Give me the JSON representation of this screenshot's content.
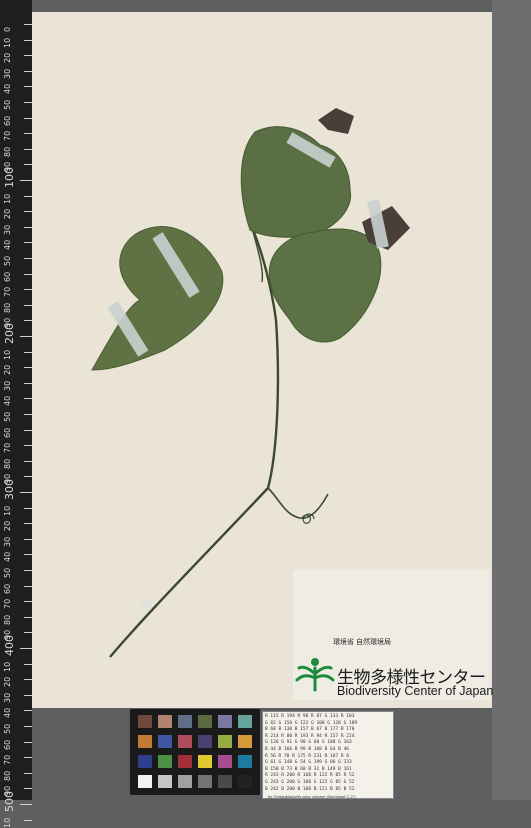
{
  "ruler": {
    "labels": [
      "0",
      "10",
      "20",
      "30",
      "40",
      "50",
      "60",
      "70",
      "80",
      "90",
      "100",
      "10",
      "20",
      "30",
      "40",
      "50",
      "60",
      "70",
      "80",
      "90",
      "200",
      "10",
      "20",
      "30",
      "40",
      "50",
      "60",
      "70",
      "80",
      "90",
      "300",
      "10",
      "20",
      "30",
      "40",
      "50",
      "60",
      "70",
      "80",
      "90",
      "400",
      "10",
      "20",
      "30",
      "40",
      "50",
      "60",
      "70",
      "80",
      "90",
      "500",
      "10"
    ],
    "colors": {
      "bg": "#1f1f20",
      "ink": "#d8d8d8"
    }
  },
  "institution": {
    "small_text": "環境省 自然環境局",
    "name_jp": "生物多様性センター",
    "name_en": "Biodiversity Center of Japan",
    "logo_color": "#1c8b3a"
  },
  "checker": {
    "swatches": [
      "#6d4a3c",
      "#b08372",
      "#5e6f87",
      "#5a6b44",
      "#7a78a0",
      "#66a39a",
      "#c27a35",
      "#3f56a0",
      "#b04b5b",
      "#4c3f71",
      "#95ad3f",
      "#d59a3a",
      "#2d3e8f",
      "#4d8f45",
      "#a03035",
      "#e3c72e",
      "#a64d92",
      "#1f7aa1",
      "#f1f1f1",
      "#c7c7c7",
      "#a0a0a0",
      "#747474",
      "#4a4a4a",
      "#222222"
    ]
  },
  "color_table": {
    "rows": [
      "R 115  R 194  R  98  R  87  G 133  R 103",
      "G  82  G 150  G 122  G 108  G 128  G 189",
      "B  68  B 130  B 157  B  67  B 177  B 170",
      "R 214  R  80  R 193  R  94  R 157  R 224",
      "G 126  G  91  G  90  G  60  G 188  G 163",
      "B  44  B 166  B  99  B 108  B  64  B  46",
      "R  56  R  70  R 175  R 231  R 187  R   8",
      "G  61  G 148  G  54  G 199  G  86  G 133",
      "B 150  B  73  B  60  B  31  B 149  B 161",
      "R 243  R 200  R 160  R 122  R  85  R  52",
      "G 243  G 200  G 160  G 122  G  85  G  52",
      "B 242  B 200  B 160  B 121  B  85  B  52"
    ],
    "caption": "by GretagMacbeth color checker (Illuminant C 2°)"
  }
}
